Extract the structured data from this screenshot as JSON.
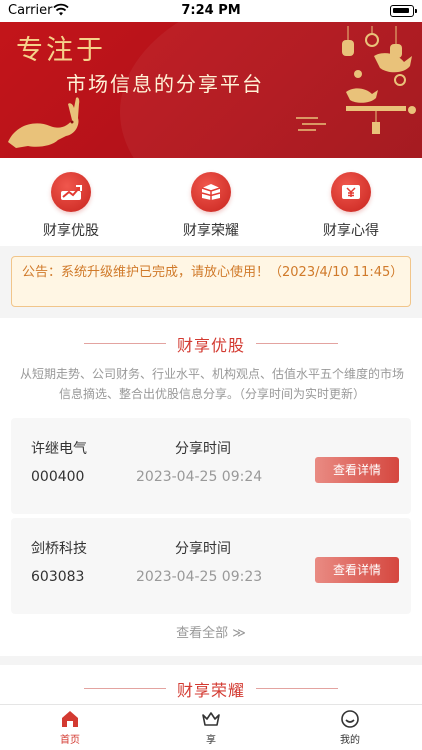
{
  "status_bar": {
    "carrier": "Carrier",
    "time": "7:24 PM"
  },
  "banner": {
    "title_line1": "专注于",
    "title_line2": "市场信息的分享平台"
  },
  "quick_nav": [
    {
      "label": "财享优股",
      "icon": "trend-up-icon"
    },
    {
      "label": "财享荣耀",
      "icon": "box-grid-icon"
    },
    {
      "label": "财享心得",
      "icon": "yen-card-icon"
    }
  ],
  "notice": {
    "text": "公告：系统升级维护已完成，请放心使用！（2023/4/10 11:45）"
  },
  "section_youxuan": {
    "title": "财享优股",
    "description": "从短期走势、公司财务、行业水平、机构观点、估值水平五个维度的市场信息摘选、整合出优股信息分享。（分享时间为实时更新）",
    "cards": [
      {
        "name": "许继电气",
        "code": "000400",
        "time_label": "分享时间",
        "time": "2023-04-25 09:24",
        "button": "查看详情"
      },
      {
        "name": "剑桥科技",
        "code": "603083",
        "time_label": "分享时间",
        "time": "2023-04-25 09:23",
        "button": "查看详情"
      }
    ],
    "view_all": "查看全部 ≫"
  },
  "section_rongyao": {
    "title": "财享荣耀"
  },
  "tab_bar": [
    {
      "label": "首页",
      "icon": "home-icon",
      "active": true
    },
    {
      "label": "享",
      "icon": "crown-icon",
      "active": false
    },
    {
      "label": "我的",
      "icon": "smiley-icon",
      "active": false
    }
  ],
  "colors": {
    "brand_red": "#d33a31",
    "banner_red": "#b5121a",
    "notice_bg": "#fff6e4",
    "notice_text": "#d07a2a"
  }
}
